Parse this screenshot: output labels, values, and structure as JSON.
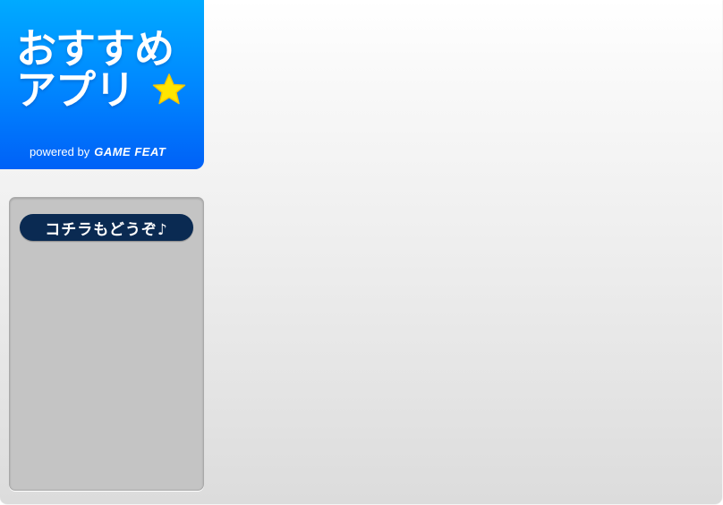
{
  "banner": {
    "title_line1": "おすすめ",
    "title_line2": "アプリ",
    "powered_by_label": "powered by",
    "powered_by_brand": "GAME FEAT",
    "star_icon": "star-icon",
    "colors": {
      "gradient_top": "#00aaff",
      "gradient_bottom": "#0061f7",
      "star": "#ffe600"
    }
  },
  "recommend_box": {
    "header_label": "コチラもどうぞ♪",
    "colors": {
      "pill": "#0a2a52",
      "box": "#c4c4c4"
    }
  }
}
